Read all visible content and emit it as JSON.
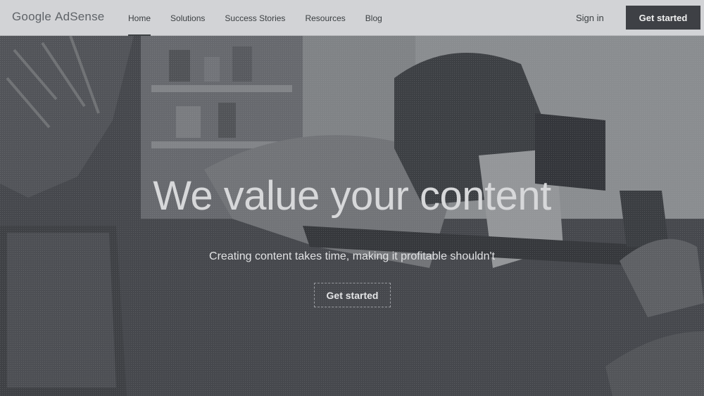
{
  "header": {
    "logo_brand": "Google",
    "logo_product": "AdSense",
    "nav": [
      {
        "label": "Home",
        "active": true
      },
      {
        "label": "Solutions",
        "active": false
      },
      {
        "label": "Success Stories",
        "active": false
      },
      {
        "label": "Resources",
        "active": false
      },
      {
        "label": "Blog",
        "active": false
      }
    ],
    "sign_in": "Sign in",
    "get_started": "Get started"
  },
  "hero": {
    "headline": "We value your content",
    "subhead": "Creating content takes time, making it profitable shouldn't",
    "cta": "Get started",
    "image_description_icon": "hero-photo"
  },
  "colors": {
    "header_bg": "#d2d3d6",
    "hero_overlay": "#4a4c52",
    "button_dark": "#3e4045"
  }
}
